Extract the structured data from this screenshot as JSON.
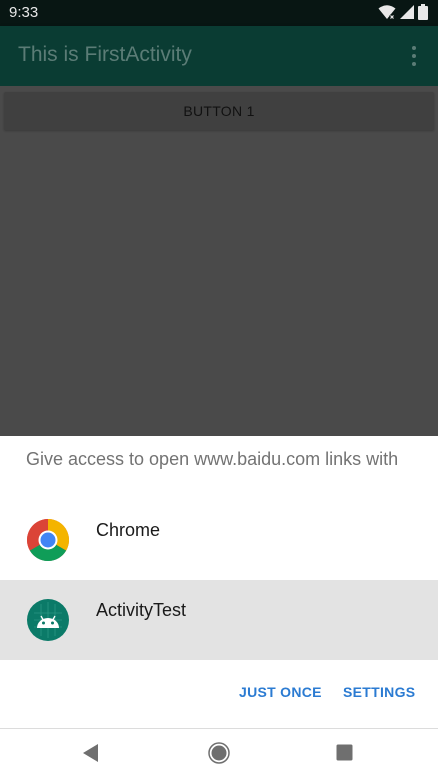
{
  "status_bar": {
    "time": "9:33",
    "icons": [
      "wifi-icon",
      "signal-icon",
      "battery-icon"
    ]
  },
  "app_bar": {
    "title": "This is FirstActivity",
    "menu_icon": "overflow-menu-icon"
  },
  "content": {
    "button1_label": "BUTTON 1"
  },
  "chooser": {
    "title": "Give access to open www.baidu.com links with",
    "apps": [
      {
        "label": "Chrome",
        "icon": "chrome-icon"
      },
      {
        "label": "ActivityTest",
        "icon": "android-app-icon"
      }
    ],
    "actions": {
      "just_once": "JUST ONCE",
      "settings": "SETTINGS"
    }
  },
  "nav_bar": {
    "buttons": [
      "back-icon",
      "home-icon",
      "recents-icon"
    ]
  },
  "colors": {
    "status_bar": "#081613",
    "app_bar": "#0a3c33",
    "scrim": "#4a4a4a",
    "accent": "#2b7bd2",
    "selected_row": "#e3e3e3"
  }
}
